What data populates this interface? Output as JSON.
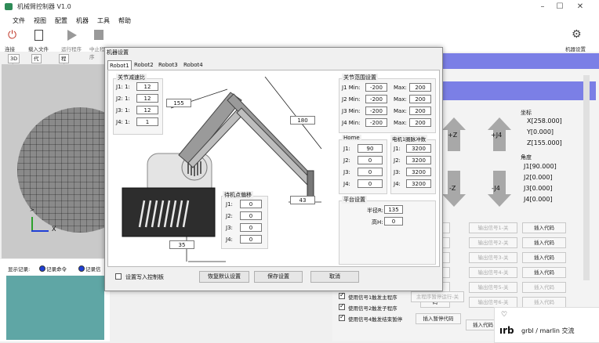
{
  "window": {
    "title": "机械臂控制器 V1.0"
  },
  "menu": [
    "文件",
    "视图",
    "配置",
    "机器",
    "工具",
    "帮助"
  ],
  "toolbar": {
    "connect": "连接",
    "load_file": "载入文件",
    "run": "运行程序",
    "stop": "中止程序",
    "machine_settings": "机器设置"
  },
  "view_tabs": [
    "3D窗口",
    "代码编辑",
    "程序通讯"
  ],
  "log": {
    "label": "显示记录:",
    "opt1": "记录命令",
    "opt2": "记录信"
  },
  "dialog": {
    "title": "机器设置",
    "tabs": [
      "Robot1",
      "Robot2",
      "Robot3",
      "Robot4"
    ],
    "reduction": {
      "title": "关节减速比",
      "rows": [
        {
          "j": "J1: 1:",
          "v": "12"
        },
        {
          "j": "J2: 1:",
          "v": "12"
        },
        {
          "j": "J3: 1:",
          "v": "12"
        },
        {
          "j": "J4: 1:",
          "v": "1"
        }
      ]
    },
    "dims": {
      "d155": "155",
      "d180": "180",
      "d43": "43",
      "d35": "35"
    },
    "offsets": {
      "title": "待机点偏移",
      "rows": [
        {
          "j": "J1:",
          "v": "0"
        },
        {
          "j": "J2:",
          "v": "0"
        },
        {
          "j": "J3:",
          "v": "0"
        },
        {
          "j": "J4:",
          "v": "0"
        }
      ]
    },
    "range": {
      "title": "关节范围设置",
      "rows": [
        {
          "j": "J1 Min:",
          "min": "-200",
          "max_label": "Max:",
          "max": "200"
        },
        {
          "j": "J2 Min:",
          "min": "-200",
          "max_label": "Max:",
          "max": "200"
        },
        {
          "j": "J3 Min:",
          "min": "-200",
          "max_label": "Max:",
          "max": "200"
        },
        {
          "j": "J4 Min:",
          "min": "-200",
          "max_label": "Max:",
          "max": "200"
        }
      ]
    },
    "home": {
      "title": "Home",
      "rows": [
        {
          "j": "J1:",
          "v": "90"
        },
        {
          "j": "J2:",
          "v": "0"
        },
        {
          "j": "J3:",
          "v": "0"
        },
        {
          "j": "J4:",
          "v": "0"
        }
      ]
    },
    "pulses": {
      "title": "电机1圈脉冲数",
      "rows": [
        {
          "j": "J1:",
          "v": "3200"
        },
        {
          "j": "J2:",
          "v": "3200"
        },
        {
          "j": "J3:",
          "v": "3200"
        },
        {
          "j": "J4:",
          "v": "3200"
        }
      ]
    },
    "platform": {
      "title": "平台设置",
      "radius_label": "半径R:",
      "radius": "135",
      "height_label": "高H:",
      "height": "0"
    },
    "write_check": "设置写入控制板",
    "btn_restore": "恢复默认设置",
    "btn_save": "保存设置",
    "btn_cancel": "取消"
  },
  "coords": {
    "title": "坐标",
    "x": "X[258.000]",
    "y": "Y[0.000]",
    "z": "Z[155.000]"
  },
  "angles": {
    "title": "角度",
    "j1": "J1[90.000]",
    "j2": "J2[0.000]",
    "j3": "J3[0.000]",
    "j4": "J4[0.000]"
  },
  "jog": {
    "z_plus": "+Z",
    "j4_plus": "+J4",
    "z_minus": "-Z",
    "j4_minus": "-J4"
  },
  "signals": {
    "left_labels": [
      "度",
      "度",
      "码",
      "码",
      "码",
      "码"
    ],
    "outputs": [
      "输出信号1-关",
      "输出信号2-关",
      "输出信号3-关",
      "输出信号4-关",
      "输出信号5-关",
      "输出信号6-关"
    ],
    "insert": "插入代码"
  },
  "bottom": {
    "chk1": "使用信号1触发主程序",
    "chk1_extra": "主程序暂停运行-关",
    "chk2": "使用信号2触发子程序",
    "chk3": "使用信号4触发结束暂停",
    "insert_pause": "插入暂停代码",
    "insert": "插入代码"
  },
  "toast": {
    "title": "grbl / marlin 交流"
  }
}
